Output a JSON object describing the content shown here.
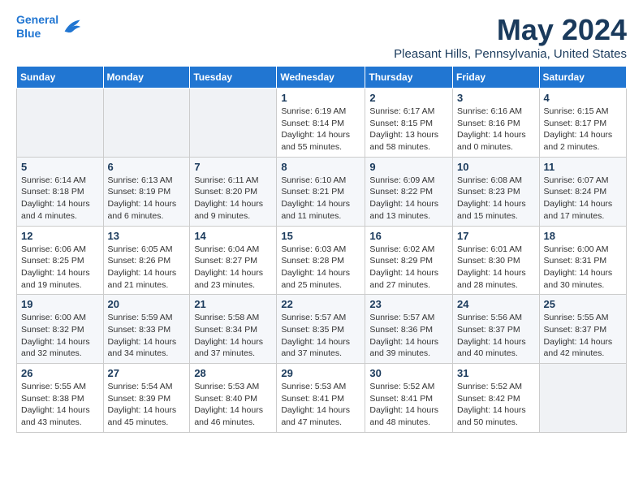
{
  "logo": {
    "text_general": "General",
    "text_blue": "Blue"
  },
  "header": {
    "month_year": "May 2024",
    "location": "Pleasant Hills, Pennsylvania, United States"
  },
  "weekdays": [
    "Sunday",
    "Monday",
    "Tuesday",
    "Wednesday",
    "Thursday",
    "Friday",
    "Saturday"
  ],
  "weeks": [
    [
      {
        "day": "",
        "info": ""
      },
      {
        "day": "",
        "info": ""
      },
      {
        "day": "",
        "info": ""
      },
      {
        "day": "1",
        "info": "Sunrise: 6:19 AM\nSunset: 8:14 PM\nDaylight: 14 hours\nand 55 minutes."
      },
      {
        "day": "2",
        "info": "Sunrise: 6:17 AM\nSunset: 8:15 PM\nDaylight: 13 hours\nand 58 minutes."
      },
      {
        "day": "3",
        "info": "Sunrise: 6:16 AM\nSunset: 8:16 PM\nDaylight: 14 hours\nand 0 minutes."
      },
      {
        "day": "4",
        "info": "Sunrise: 6:15 AM\nSunset: 8:17 PM\nDaylight: 14 hours\nand 2 minutes."
      }
    ],
    [
      {
        "day": "5",
        "info": "Sunrise: 6:14 AM\nSunset: 8:18 PM\nDaylight: 14 hours\nand 4 minutes."
      },
      {
        "day": "6",
        "info": "Sunrise: 6:13 AM\nSunset: 8:19 PM\nDaylight: 14 hours\nand 6 minutes."
      },
      {
        "day": "7",
        "info": "Sunrise: 6:11 AM\nSunset: 8:20 PM\nDaylight: 14 hours\nand 9 minutes."
      },
      {
        "day": "8",
        "info": "Sunrise: 6:10 AM\nSunset: 8:21 PM\nDaylight: 14 hours\nand 11 minutes."
      },
      {
        "day": "9",
        "info": "Sunrise: 6:09 AM\nSunset: 8:22 PM\nDaylight: 14 hours\nand 13 minutes."
      },
      {
        "day": "10",
        "info": "Sunrise: 6:08 AM\nSunset: 8:23 PM\nDaylight: 14 hours\nand 15 minutes."
      },
      {
        "day": "11",
        "info": "Sunrise: 6:07 AM\nSunset: 8:24 PM\nDaylight: 14 hours\nand 17 minutes."
      }
    ],
    [
      {
        "day": "12",
        "info": "Sunrise: 6:06 AM\nSunset: 8:25 PM\nDaylight: 14 hours\nand 19 minutes."
      },
      {
        "day": "13",
        "info": "Sunrise: 6:05 AM\nSunset: 8:26 PM\nDaylight: 14 hours\nand 21 minutes."
      },
      {
        "day": "14",
        "info": "Sunrise: 6:04 AM\nSunset: 8:27 PM\nDaylight: 14 hours\nand 23 minutes."
      },
      {
        "day": "15",
        "info": "Sunrise: 6:03 AM\nSunset: 8:28 PM\nDaylight: 14 hours\nand 25 minutes."
      },
      {
        "day": "16",
        "info": "Sunrise: 6:02 AM\nSunset: 8:29 PM\nDaylight: 14 hours\nand 27 minutes."
      },
      {
        "day": "17",
        "info": "Sunrise: 6:01 AM\nSunset: 8:30 PM\nDaylight: 14 hours\nand 28 minutes."
      },
      {
        "day": "18",
        "info": "Sunrise: 6:00 AM\nSunset: 8:31 PM\nDaylight: 14 hours\nand 30 minutes."
      }
    ],
    [
      {
        "day": "19",
        "info": "Sunrise: 6:00 AM\nSunset: 8:32 PM\nDaylight: 14 hours\nand 32 minutes."
      },
      {
        "day": "20",
        "info": "Sunrise: 5:59 AM\nSunset: 8:33 PM\nDaylight: 14 hours\nand 34 minutes."
      },
      {
        "day": "21",
        "info": "Sunrise: 5:58 AM\nSunset: 8:34 PM\nDaylight: 14 hours\nand 37 minutes."
      },
      {
        "day": "22",
        "info": "Sunrise: 5:57 AM\nSunset: 8:35 PM\nDaylight: 14 hours\nand 37 minutes."
      },
      {
        "day": "23",
        "info": "Sunrise: 5:57 AM\nSunset: 8:36 PM\nDaylight: 14 hours\nand 39 minutes."
      },
      {
        "day": "24",
        "info": "Sunrise: 5:56 AM\nSunset: 8:37 PM\nDaylight: 14 hours\nand 40 minutes."
      },
      {
        "day": "25",
        "info": "Sunrise: 5:55 AM\nSunset: 8:37 PM\nDaylight: 14 hours\nand 42 minutes."
      }
    ],
    [
      {
        "day": "26",
        "info": "Sunrise: 5:55 AM\nSunset: 8:38 PM\nDaylight: 14 hours\nand 43 minutes."
      },
      {
        "day": "27",
        "info": "Sunrise: 5:54 AM\nSunset: 8:39 PM\nDaylight: 14 hours\nand 45 minutes."
      },
      {
        "day": "28",
        "info": "Sunrise: 5:53 AM\nSunset: 8:40 PM\nDaylight: 14 hours\nand 46 minutes."
      },
      {
        "day": "29",
        "info": "Sunrise: 5:53 AM\nSunset: 8:41 PM\nDaylight: 14 hours\nand 47 minutes."
      },
      {
        "day": "30",
        "info": "Sunrise: 5:52 AM\nSunset: 8:41 PM\nDaylight: 14 hours\nand 48 minutes."
      },
      {
        "day": "31",
        "info": "Sunrise: 5:52 AM\nSunset: 8:42 PM\nDaylight: 14 hours\nand 50 minutes."
      },
      {
        "day": "",
        "info": ""
      }
    ]
  ]
}
